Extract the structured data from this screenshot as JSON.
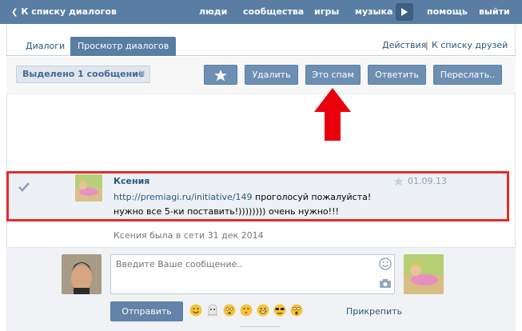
{
  "topbar": {
    "back_label": "К списку диалогов",
    "nav": [
      "люди",
      "сообщества",
      "игры",
      "музыка",
      "помощь",
      "выйти"
    ]
  },
  "tabs": {
    "dialogs": "Диалоги",
    "view_dialogs": "Просмотр диалогов",
    "actions": "Действия",
    "separator": "|",
    "to_friends": "К списку друзей"
  },
  "toolbar": {
    "selected": "Выделено 1 сообщение",
    "delete": "Удалить",
    "spam": "Это спам",
    "reply": "Ответить",
    "forward": "Переслать.."
  },
  "message": {
    "sender": "Ксения",
    "link": "http://premiagi.ru/initiative/149",
    "text": " проголосуй пожалуйста! нужно все 5-ки поставить!)))))))) очень нужно!!!",
    "date": "01.09.13"
  },
  "status": {
    "online": "Ксения была в сети 31 дек 2014"
  },
  "compose": {
    "placeholder": "Введите Ваше сообщение..",
    "send": "Отправить",
    "attach": "Прикрепить"
  },
  "colors": {
    "header": "#597da3",
    "button": "#6d8fb3",
    "highlight_border": "#e22d2d",
    "arrow": "#e8000b",
    "link": "#2b587a"
  }
}
